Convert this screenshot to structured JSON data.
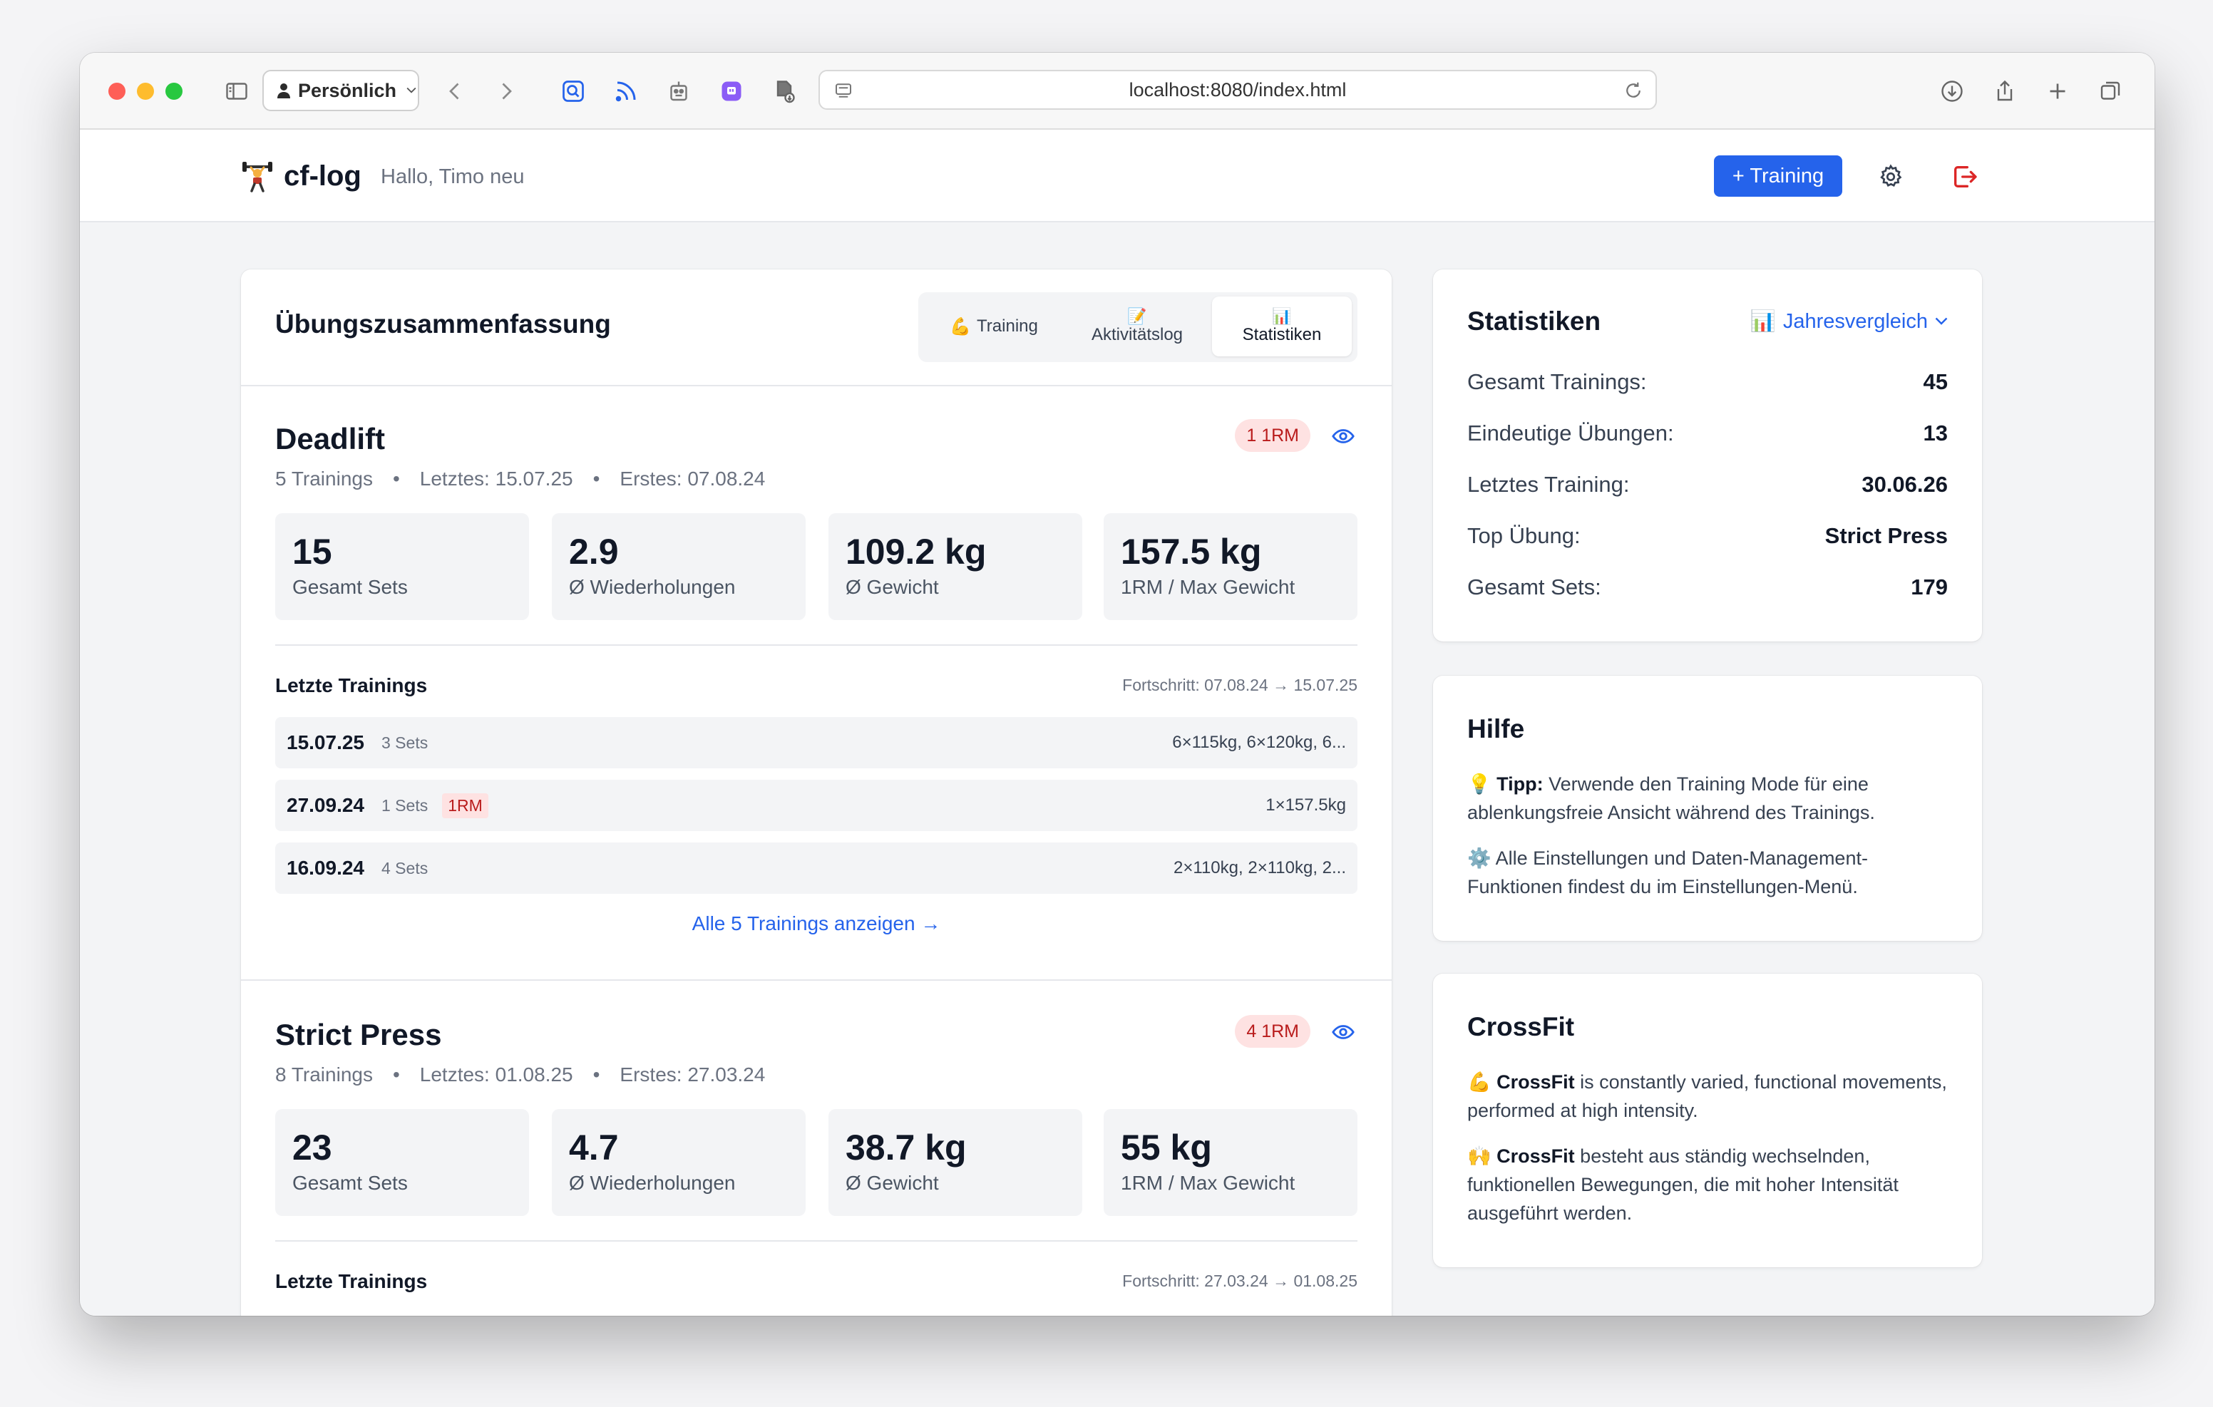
{
  "browser": {
    "profile_label": "Persönlich",
    "url": "localhost:8080/index.html"
  },
  "header": {
    "brand": "cf-log",
    "greeting": "Hallo, Timo neu",
    "add_training_label": "+ Training"
  },
  "summary": {
    "title": "Übungszusammenfassung",
    "tabs": [
      {
        "emoji": "💪",
        "label": "Training"
      },
      {
        "emoji": "📝",
        "label": "Aktivitätslog"
      },
      {
        "emoji": "📊",
        "label": "Statistiken"
      }
    ],
    "active_tab": "Statistiken",
    "exercises": [
      {
        "name": "Deadlift",
        "trainings": "5 Trainings",
        "last": "Letztes: 15.07.25",
        "first": "Erstes: 07.08.24",
        "rm_badge": "1 1RM",
        "stats": [
          {
            "value": "15",
            "label": "Gesamt Sets"
          },
          {
            "value": "2.9",
            "label": "Ø Wiederholungen"
          },
          {
            "value": "109.2 kg",
            "label": "Ø Gewicht"
          },
          {
            "value": "157.5 kg",
            "label": "1RM / Max Gewicht"
          }
        ],
        "recent_title": "Letzte Trainings",
        "progress": "Fortschritt: 07.08.24 → 15.07.25",
        "sessions": [
          {
            "date": "15.07.25",
            "sets": "3 Sets",
            "badge": "",
            "weights": "6×115kg, 6×120kg, 6..."
          },
          {
            "date": "27.09.24",
            "sets": "1 Sets",
            "badge": "1RM",
            "weights": "1×157.5kg"
          },
          {
            "date": "16.09.24",
            "sets": "4 Sets",
            "badge": "",
            "weights": "2×110kg, 2×110kg, 2..."
          }
        ],
        "show_all": "Alle 5 Trainings anzeigen →"
      },
      {
        "name": "Strict Press",
        "trainings": "8 Trainings",
        "last": "Letztes: 01.08.25",
        "first": "Erstes: 27.03.24",
        "rm_badge": "4 1RM",
        "stats": [
          {
            "value": "23",
            "label": "Gesamt Sets"
          },
          {
            "value": "4.7",
            "label": "Ø Wiederholungen"
          },
          {
            "value": "38.7 kg",
            "label": "Ø Gewicht"
          },
          {
            "value": "55 kg",
            "label": "1RM / Max Gewicht"
          }
        ],
        "recent_title": "Letzte Trainings",
        "progress": "Fortschritt: 27.03.24 → 01.08.25"
      }
    ]
  },
  "statistics": {
    "title": "Statistiken",
    "selector_emoji": "📊",
    "selector_label": "Jahresvergleich",
    "rows": [
      {
        "key": "Gesamt Trainings:",
        "value": "45"
      },
      {
        "key": "Eindeutige Übungen:",
        "value": "13"
      },
      {
        "key": "Letztes Training:",
        "value": "30.06.26"
      },
      {
        "key": "Top Übung:",
        "value": "Strict Press"
      },
      {
        "key": "Gesamt Sets:",
        "value": "179"
      }
    ]
  },
  "help": {
    "title": "Hilfe",
    "tip_emoji": "💡",
    "tip_bold": "Tipp:",
    "tip_text": " Verwende den Training Mode für eine ablenkungsfreie Ansicht während des Trainings.",
    "settings_emoji": "⚙️",
    "settings_text": " Alle Einstellungen und Daten-Management-Funktionen findest du im Einstellungen-Menü."
  },
  "crossfit": {
    "title": "CrossFit",
    "en_emoji": "💪",
    "en_bold": "CrossFit",
    "en_text": " is constantly varied, functional movements, performed at high intensity.",
    "de_emoji": "🙌",
    "de_bold": "CrossFit",
    "de_text": " besteht aus ständig wechselnden, funktionellen Bewegungen, die mit hoher Intensität ausgeführt werden."
  },
  "colors": {
    "accent": "#2563eb",
    "danger": "#dc2626",
    "badge_bg": "#fee2e2",
    "badge_text": "#b91c1c"
  }
}
